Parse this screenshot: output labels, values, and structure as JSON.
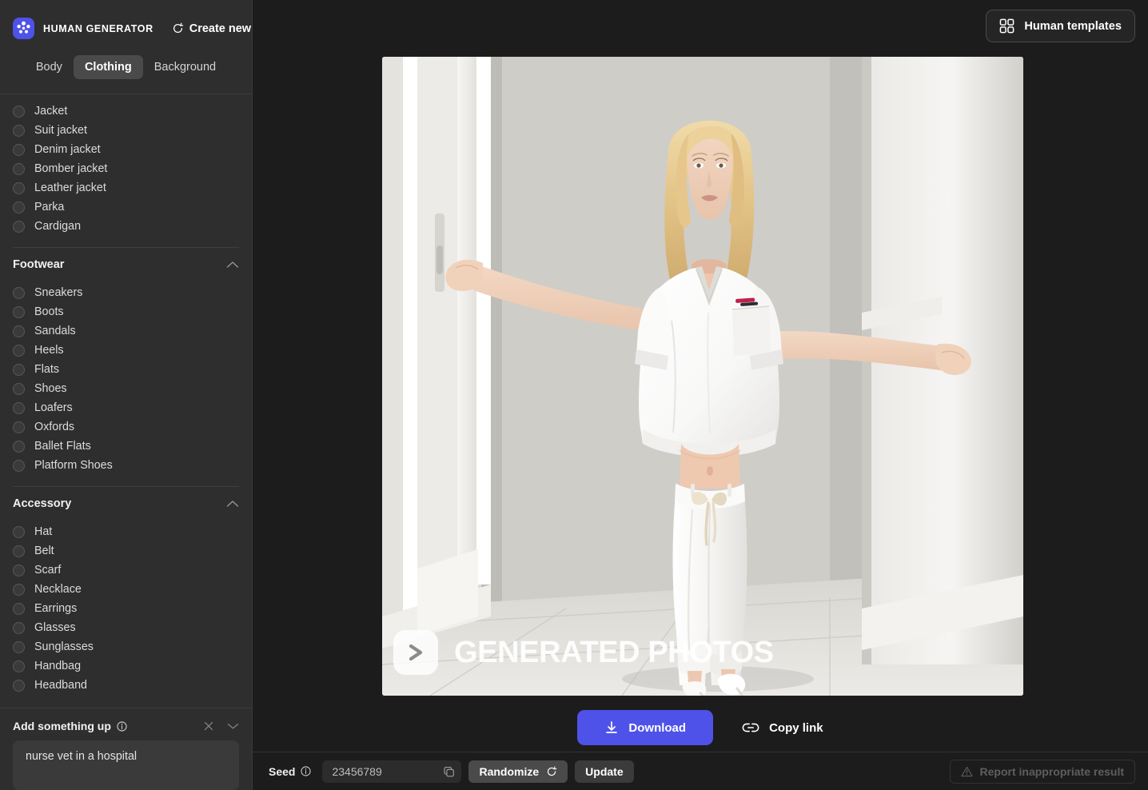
{
  "app": {
    "brand": "HUMAN GENERATOR",
    "create_new": "Create new",
    "accent_color": "#4f52e8",
    "sidebar_bg": "#2e2e2e",
    "main_bg": "#1c1c1c"
  },
  "tabs": [
    {
      "label": "Body",
      "active": false
    },
    {
      "label": "Clothing",
      "active": true
    },
    {
      "label": "Background",
      "active": false
    }
  ],
  "sidebar": {
    "top_list": [
      {
        "label": "Jacket",
        "selected": false
      },
      {
        "label": "Suit jacket",
        "selected": false
      },
      {
        "label": "Denim jacket",
        "selected": false
      },
      {
        "label": "Bomber jacket",
        "selected": false
      },
      {
        "label": "Leather jacket",
        "selected": false
      },
      {
        "label": "Parka",
        "selected": false
      },
      {
        "label": "Cardigan",
        "selected": false
      }
    ],
    "groups": [
      {
        "title": "Footwear",
        "expanded": true,
        "items": [
          {
            "label": "Sneakers",
            "selected": false
          },
          {
            "label": "Boots",
            "selected": false
          },
          {
            "label": "Sandals",
            "selected": false
          },
          {
            "label": "Heels",
            "selected": false
          },
          {
            "label": "Flats",
            "selected": false
          },
          {
            "label": "Shoes",
            "selected": false
          },
          {
            "label": "Loafers",
            "selected": false
          },
          {
            "label": "Oxfords",
            "selected": false
          },
          {
            "label": "Ballet Flats",
            "selected": false
          },
          {
            "label": "Platform Shoes",
            "selected": false
          }
        ]
      },
      {
        "title": "Accessory",
        "expanded": true,
        "items": [
          {
            "label": "Hat",
            "selected": false
          },
          {
            "label": "Belt",
            "selected": false
          },
          {
            "label": "Scarf",
            "selected": false
          },
          {
            "label": "Necklace",
            "selected": false
          },
          {
            "label": "Earrings",
            "selected": false
          },
          {
            "label": "Glasses",
            "selected": false
          },
          {
            "label": "Sunglasses",
            "selected": false
          },
          {
            "label": "Handbag",
            "selected": false
          },
          {
            "label": "Headband",
            "selected": false
          }
        ]
      }
    ],
    "prompt": {
      "title": "Add something up",
      "value": "nurse vet in a hospital",
      "placeholder": ""
    }
  },
  "header": {
    "templates_button": "Human templates"
  },
  "preview": {
    "watermark_text": "GENERATED PHOTOS",
    "watermark_badge_icon": "chevron-right-glyph",
    "alt": "Generated photo of a blonde woman in white nurse scrubs standing in a bright white hospital corridor, arms outstretched touching the walls"
  },
  "actions": {
    "download": "Download",
    "copy_link": "Copy link"
  },
  "bottom": {
    "seed_label": "Seed",
    "seed_value": "23456789",
    "randomize": "Randomize",
    "update": "Update",
    "report": "Report inappropriate result"
  }
}
